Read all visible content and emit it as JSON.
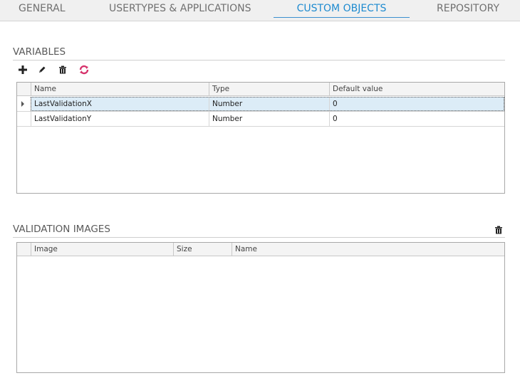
{
  "tabs": [
    {
      "label": "GENERAL",
      "active": false
    },
    {
      "label": "USERTYPES & APPLICATIONS",
      "active": false
    },
    {
      "label": "CUSTOM OBJECTS",
      "active": true
    },
    {
      "label": "REPOSITORY",
      "active": false
    }
  ],
  "variables": {
    "title": "VARIABLES",
    "toolbar": [
      "add-icon",
      "edit-icon",
      "delete-icon",
      "refresh-icon"
    ],
    "columns": [
      "Name",
      "Type",
      "Default value"
    ],
    "rows": [
      {
        "name": "LastValidationX",
        "type": "Number",
        "default": "0",
        "selected": true
      },
      {
        "name": "LastValidationY",
        "type": "Number",
        "default": "0",
        "selected": false
      }
    ]
  },
  "validation_images": {
    "title": "VALIDATION IMAGES",
    "toolbar": [
      "delete-icon"
    ],
    "columns": [
      "Image",
      "Size",
      "Name"
    ],
    "rows": []
  },
  "colors": {
    "accent": "#1e8bd0",
    "refresh_icon": "#d6336c",
    "selected_row": "#dcecf7"
  }
}
